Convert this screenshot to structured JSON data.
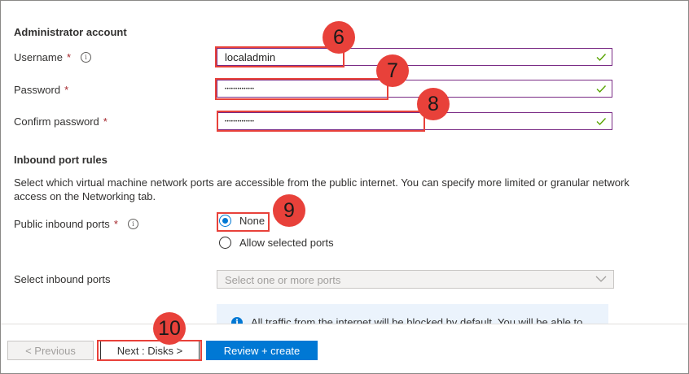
{
  "admin": {
    "section_title": "Administrator account",
    "username_label": "Username",
    "username_value": "localadmin",
    "password_label": "Password",
    "password_value": "••••••••••••••",
    "confirm_label": "Confirm password",
    "confirm_value": "••••••••••••••",
    "required_mark": "*",
    "info_icon": "i"
  },
  "inbound": {
    "section_title": "Inbound port rules",
    "description": "Select which virtual machine network ports are accessible from the public internet. You can specify more limited or granular network access on the Networking tab.",
    "public_ports_label": "Public inbound ports",
    "options": [
      {
        "label": "None",
        "selected": true
      },
      {
        "label": "Allow selected ports",
        "selected": false
      }
    ],
    "select_ports_label": "Select inbound ports",
    "select_ports_placeholder": "Select one or more ports",
    "info_text": "All traffic from the internet will be blocked by default. You will be able to"
  },
  "footer": {
    "previous_label": "< Previous",
    "next_label": "Next : Disks >",
    "review_label": "Review + create"
  },
  "callouts": [
    "6",
    "7",
    "8",
    "9",
    "10"
  ],
  "colors": {
    "accent": "#0078d4",
    "callout": "#e8413a",
    "valid_border": "#7a2b85",
    "valid_check": "#57a300",
    "required": "#a4262c"
  }
}
